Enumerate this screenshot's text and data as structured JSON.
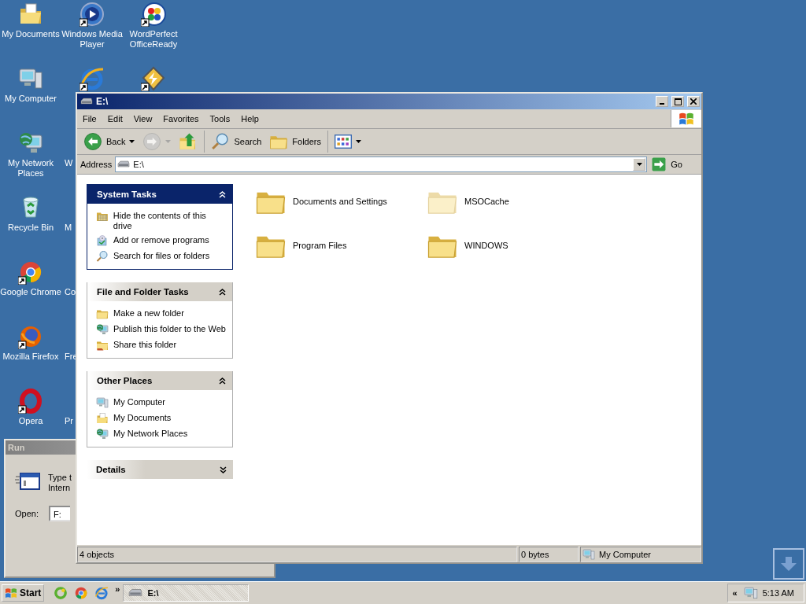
{
  "desktop_icons": [
    {
      "kind": "documents",
      "label": "My Documents",
      "shortcut": false
    },
    {
      "kind": "computer",
      "label": "My Computer",
      "shortcut": false
    },
    {
      "kind": "network",
      "label": "My Network Places",
      "shortcut": false
    },
    {
      "kind": "recycle",
      "label": "Recycle Bin",
      "shortcut": false
    },
    {
      "kind": "chrome",
      "label": "Google Chrome",
      "shortcut": true
    },
    {
      "kind": "firefox",
      "label": "Mozilla Firefox",
      "shortcut": true
    },
    {
      "kind": "opera",
      "label": "Opera",
      "shortcut": true
    },
    {
      "kind": "media",
      "label": "Windows Media Player",
      "shortcut": true
    },
    {
      "kind": "ie",
      "shortcut": true
    },
    {
      "kind": "covered",
      "label": "W"
    },
    {
      "kind": "covered",
      "label": "M"
    },
    {
      "kind": "covered",
      "label": "Co"
    },
    {
      "kind": "covered",
      "label": "Fre"
    },
    {
      "kind": "covered",
      "label": "Pr"
    },
    {
      "kind": "wordperfect",
      "label": "WordPerfect OfficeReady",
      "shortcut": true
    },
    {
      "kind": "tool",
      "shortcut": true
    }
  ],
  "run_dialog": {
    "title": "Run",
    "prompt": [
      "Type t",
      "Intern"
    ],
    "open_label": "Open:",
    "open_value": "F:"
  },
  "window": {
    "title": "E:\\",
    "menu": [
      "File",
      "Edit",
      "View",
      "Favorites",
      "Tools",
      "Help"
    ],
    "toolbar": [
      [
        {
          "kind": "back",
          "label": "Back",
          "dropdown": true,
          "disabled": false
        },
        {
          "kind": "forward",
          "dropdown": true,
          "disabled": true
        },
        {
          "kind": "up",
          "dropdown": false,
          "disabled": false
        }
      ],
      [
        {
          "kind": "search",
          "label": "Search",
          "dropdown": false,
          "disabled": false
        },
        {
          "kind": "folders",
          "label": "Folders",
          "dropdown": false,
          "disabled": false
        }
      ],
      [
        {
          "kind": "views",
          "dropdown": true,
          "disabled": false
        }
      ]
    ],
    "address": {
      "label": "Address",
      "value": "E:\\",
      "go": "Go"
    },
    "panels": [
      {
        "title": "System Tasks",
        "kind": "special",
        "expanded": true,
        "items": [
          {
            "label": "Hide the contents of this drive"
          },
          {
            "label": "Add or remove programs"
          },
          {
            "label": "Search for files or folders"
          }
        ]
      },
      {
        "title": "File and Folder Tasks",
        "kind": "normal",
        "expanded": true,
        "items": [
          {
            "label": "Make a new folder"
          },
          {
            "label": "Publish this folder to the Web"
          },
          {
            "label": "Share this folder"
          }
        ]
      },
      {
        "title": "Other Places",
        "kind": "normal",
        "expanded": true,
        "items": [
          {
            "label": "My Computer"
          },
          {
            "label": "My Documents"
          },
          {
            "label": "My Network Places"
          }
        ]
      },
      {
        "title": "Details",
        "kind": "normal",
        "expanded": false
      }
    ],
    "folders": [
      {
        "name": "Documents and Settings",
        "hidden": false
      },
      {
        "name": "MSOCache",
        "hidden": true
      },
      {
        "name": "Program Files",
        "hidden": false
      },
      {
        "name": "WINDOWS",
        "hidden": false
      }
    ],
    "status_bar": [
      {
        "text": "4 objects"
      },
      {
        "text": "0 bytes"
      },
      {
        "text": "My Computer"
      }
    ]
  },
  "taskbar": {
    "start": "Start",
    "quick_launch": [
      {
        "kind": "ring"
      },
      {
        "kind": "chrome"
      },
      {
        "kind": "ie"
      }
    ],
    "more": "»",
    "tasks": [
      {
        "label": "E:\\",
        "selected": true
      }
    ],
    "tray_toggle": "«",
    "clock": "5:13 AM"
  }
}
